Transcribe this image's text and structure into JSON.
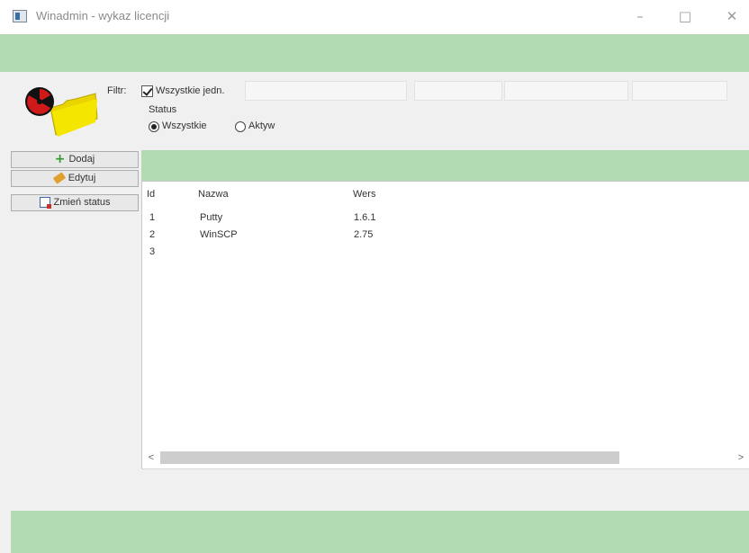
{
  "window": {
    "title": "Winadmin - wykaz licencji",
    "min_glyph": "–",
    "max_glyph": "□",
    "close_glyph": "✕"
  },
  "filter": {
    "label": "Filtr:",
    "checkbox_label": "Wszystkie jedn.",
    "checkbox_checked": true,
    "status_label": "Status",
    "radio_all": "Wszystkie",
    "radio_active": "Aktyw",
    "selected": "Wszystkie"
  },
  "actions": {
    "add": "Dodaj",
    "edit": "Edytuj",
    "change_status": "Zmień status"
  },
  "table": {
    "columns": [
      "Id",
      "Nazwa",
      "Wers"
    ],
    "rows": [
      {
        "id": "1",
        "name": "Putty",
        "version": "1.6.1"
      },
      {
        "id": "2",
        "name": "WinSCP",
        "version": "2.75"
      },
      {
        "id": "3",
        "name": "",
        "version": ""
      }
    ]
  },
  "scrollbar": {
    "left_glyph": "<",
    "right_glyph": ">"
  },
  "colors": {
    "accent_green": "#b3dbb3",
    "window_bg": "#f0f0f0"
  }
}
